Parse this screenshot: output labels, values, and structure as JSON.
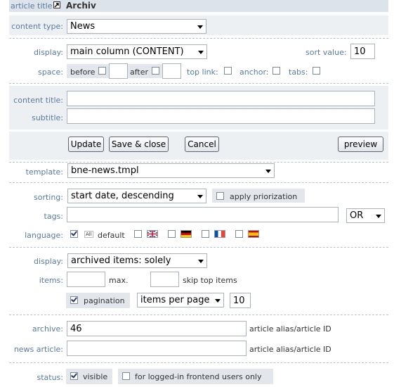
{
  "header": {
    "label": "article title",
    "title": "Archiv"
  },
  "content_type": {
    "label": "content type:",
    "value": "News"
  },
  "display_row": {
    "label": "display:",
    "value": "main column (CONTENT)",
    "sort_label": "sort value:",
    "sort_value": "10"
  },
  "space_row": {
    "label": "space:",
    "before": "before",
    "after": "after",
    "top_link": "top link:",
    "anchor": "anchor:",
    "tabs": "tabs:"
  },
  "titles": {
    "content_title_label": "content title:",
    "subtitle_label": "subtitle:"
  },
  "buttons": {
    "update": "Update",
    "save_close": "Save & close",
    "cancel": "Cancel",
    "preview": "preview"
  },
  "template": {
    "label": "template:",
    "value": "bne-news.tmpl"
  },
  "sorting": {
    "label": "sorting:",
    "value": "start date, descending",
    "priorization": "apply priorization"
  },
  "tags": {
    "label": "tags:",
    "operator": "OR"
  },
  "language": {
    "label": "language:",
    "all_icon": "All",
    "default": "default"
  },
  "display2": {
    "label": "display:",
    "value": "archived items: solely"
  },
  "items": {
    "label": "items:",
    "max": "max.",
    "skip": "skip top items"
  },
  "pagination": {
    "label": "pagination",
    "mode": "items per page",
    "count": "10"
  },
  "archive": {
    "label": "archive:",
    "value": "46",
    "hint": "article alias/article ID"
  },
  "news_article": {
    "label": "news article:",
    "value": "",
    "hint": "article alias/article ID"
  },
  "status": {
    "label": "status:",
    "visible": "visible",
    "logged_in": "for logged-in frontend users only"
  },
  "colors": {
    "label": "#5a7aa0",
    "section_bg": "#edf0f3"
  }
}
